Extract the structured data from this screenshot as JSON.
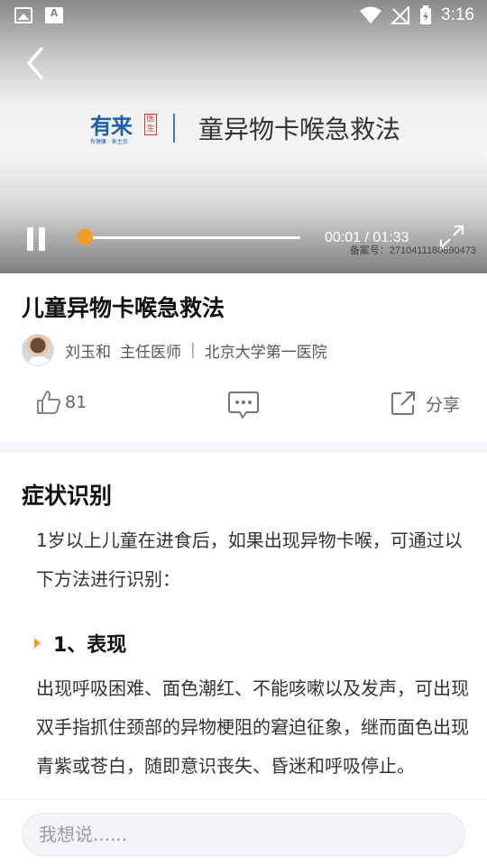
{
  "status_bar": {
    "time": "3:16"
  },
  "video": {
    "banner_title": "童异物卡喉急救法",
    "logo": {
      "name": "有来",
      "tag": "医生",
      "sub": "有健康 · 家主页"
    },
    "current_time": "00:01",
    "time_sep": " / ",
    "duration": "01:33",
    "record_no": "备案号：2710411180890473",
    "progress": 0.01
  },
  "article": {
    "title": "儿童异物卡喉急救法",
    "author_name": "刘玉和",
    "author_title": "主任医师",
    "separator": "|",
    "hospital": "北京大学第一医院"
  },
  "actions": {
    "like_count": "81",
    "share_label": "分享"
  },
  "content": {
    "section_title": "症状识别",
    "intro": "1岁以上儿童在进食后，如果出现异物卡喉，可通过以下方法进行识别：",
    "sub_title": "1、表现",
    "sub_text": "出现呼吸困难、面色潮红、不能咳嗽以及发声，可出现双手指抓住颈部的异物梗阻的窘迫征象，继而面色出现青紫或苍白，随即意识丧失、昏迷和呼吸停止。"
  },
  "comment_bar": {
    "placeholder": "我想说......"
  },
  "colors": {
    "accent": "#f39c26",
    "brand_blue": "#1f5fae"
  }
}
